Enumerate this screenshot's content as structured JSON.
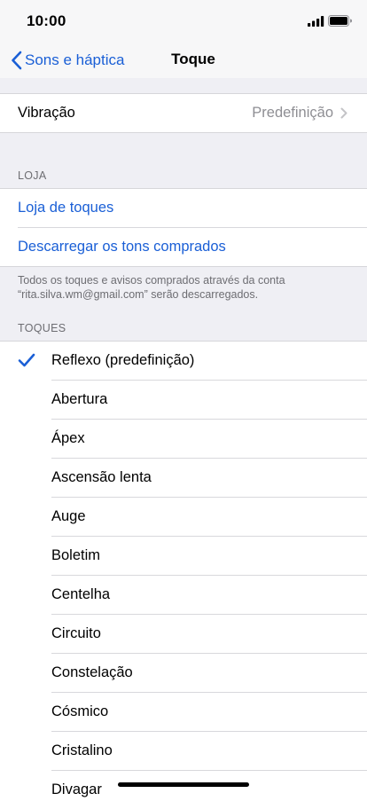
{
  "status": {
    "time": "10:00"
  },
  "nav": {
    "back_label": "Sons e háptica",
    "title": "Toque"
  },
  "vibration": {
    "label": "Vibração",
    "value": "Predefinição"
  },
  "store": {
    "header": "LOJA",
    "links": [
      "Loja de toques",
      "Descarregar os tons comprados"
    ],
    "footer": "Todos os toques e avisos comprados através da conta “rita.silva.wm@gmail.com” serão descarregados."
  },
  "tones": {
    "header": "TOQUES",
    "selected_index": 0,
    "items": [
      "Reflexo (predefinição)",
      "Abertura",
      "Ápex",
      "Ascensão lenta",
      "Auge",
      "Boletim",
      "Centelha",
      "Circuito",
      "Constelação",
      "Cósmico",
      "Cristalino",
      "Divagar"
    ]
  },
  "colors": {
    "accent": "#1a5fd6",
    "background": "#efeff4",
    "secondary_text": "#8e8e93"
  }
}
